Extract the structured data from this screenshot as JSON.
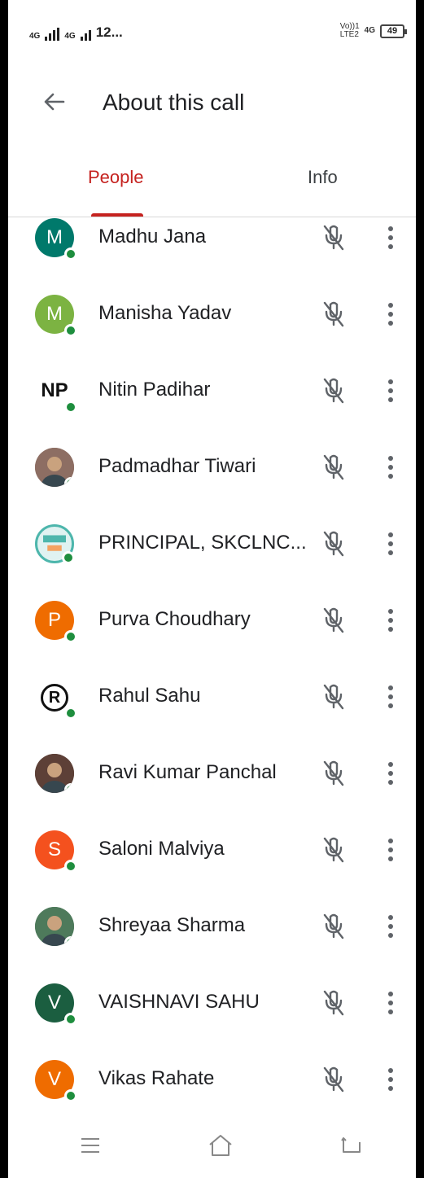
{
  "status_bar": {
    "net1": "4G",
    "net2": "4G",
    "time": "12...",
    "volte": "Vo))1",
    "lte": "LTE2",
    "net3": "4G",
    "battery": "49"
  },
  "header": {
    "title": "About this call",
    "back_icon": "arrow-back-icon"
  },
  "tabs": [
    {
      "label": "People",
      "selected": true
    },
    {
      "label": "Info",
      "selected": false
    }
  ],
  "participants": [
    {
      "name": "Madhu Jana",
      "initial": "M",
      "avatar_color": "#00796b",
      "avatar_type": "letter",
      "mic": "muted",
      "online": true
    },
    {
      "name": "Manisha Yadav",
      "initial": "M",
      "avatar_color": "#7cb342",
      "avatar_type": "letter",
      "mic": "muted",
      "online": true
    },
    {
      "name": "Nitin Padihar",
      "initial": "NP",
      "avatar_color": "#ffffff",
      "avatar_type": "logo",
      "mic": "muted",
      "online": true
    },
    {
      "name": "Padmadhar Tiwari",
      "initial": "",
      "avatar_color": "#8d6e63",
      "avatar_type": "photo",
      "mic": "muted",
      "online": true
    },
    {
      "name": "PRINCIPAL, SKCLNC...",
      "initial": "",
      "avatar_color": "#4db6ac",
      "avatar_type": "badge",
      "mic": "muted",
      "online": true
    },
    {
      "name": "Purva Choudhary",
      "initial": "P",
      "avatar_color": "#ef6c00",
      "avatar_type": "letter",
      "mic": "muted",
      "online": true
    },
    {
      "name": "Rahul Sahu",
      "initial": "R",
      "avatar_color": "#ffffff",
      "avatar_type": "logo",
      "mic": "muted",
      "online": true
    },
    {
      "name": "Ravi Kumar Panchal",
      "initial": "",
      "avatar_color": "#5d4037",
      "avatar_type": "photo",
      "mic": "muted",
      "online": true
    },
    {
      "name": "Saloni Malviya",
      "initial": "S",
      "avatar_color": "#f4511e",
      "avatar_type": "letter",
      "mic": "muted",
      "online": true
    },
    {
      "name": "Shreyaa Sharma",
      "initial": "",
      "avatar_color": "#4e7a5b",
      "avatar_type": "photo",
      "mic": "muted",
      "online": true
    },
    {
      "name": "VAISHNAVI SAHU",
      "initial": "V",
      "avatar_color": "#1b5e40",
      "avatar_type": "letter",
      "mic": "muted",
      "online": true
    },
    {
      "name": "Vikas Rahate",
      "initial": "V",
      "avatar_color": "#ef6c00",
      "avatar_type": "letter",
      "mic": "muted",
      "online": true
    }
  ],
  "icons": {
    "mic": "mic-off-icon",
    "more": "more-vert-icon",
    "presence": "online-dot-icon"
  },
  "nav_bar": {
    "menu": "menu-icon",
    "home": "home-icon",
    "back": "back-icon"
  }
}
